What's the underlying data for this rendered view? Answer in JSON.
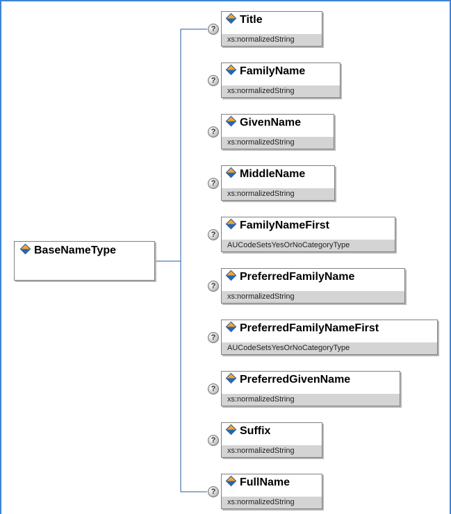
{
  "root": {
    "name": "BaseNameType"
  },
  "help_glyph": "?",
  "children": [
    {
      "name": "Title",
      "type": "xs:normalizedString",
      "occurrence": "optional"
    },
    {
      "name": "FamilyName",
      "type": "xs:normalizedString",
      "occurrence": "optional"
    },
    {
      "name": "GivenName",
      "type": "xs:normalizedString",
      "occurrence": "optional"
    },
    {
      "name": "MiddleName",
      "type": "xs:normalizedString",
      "occurrence": "optional"
    },
    {
      "name": "FamilyNameFirst",
      "type": "AUCodeSetsYesOrNoCategoryType",
      "occurrence": "optional"
    },
    {
      "name": "PreferredFamilyName",
      "type": "xs:normalizedString",
      "occurrence": "optional"
    },
    {
      "name": "PreferredFamilyNameFirst",
      "type": "AUCodeSetsYesOrNoCategoryType",
      "occurrence": "optional"
    },
    {
      "name": "PreferredGivenName",
      "type": "xs:normalizedString",
      "occurrence": "optional"
    },
    {
      "name": "Suffix",
      "type": "xs:normalizedString",
      "occurrence": "optional"
    },
    {
      "name": "FullName",
      "type": "xs:normalizedString",
      "occurrence": "optional"
    }
  ],
  "colors": {
    "frame": "#3e84d4",
    "connector": "#1f5aa6",
    "type_band": "#d4d4d4"
  },
  "icons": {
    "element": "element-diamond-icon",
    "optional": "help-circle-icon"
  }
}
